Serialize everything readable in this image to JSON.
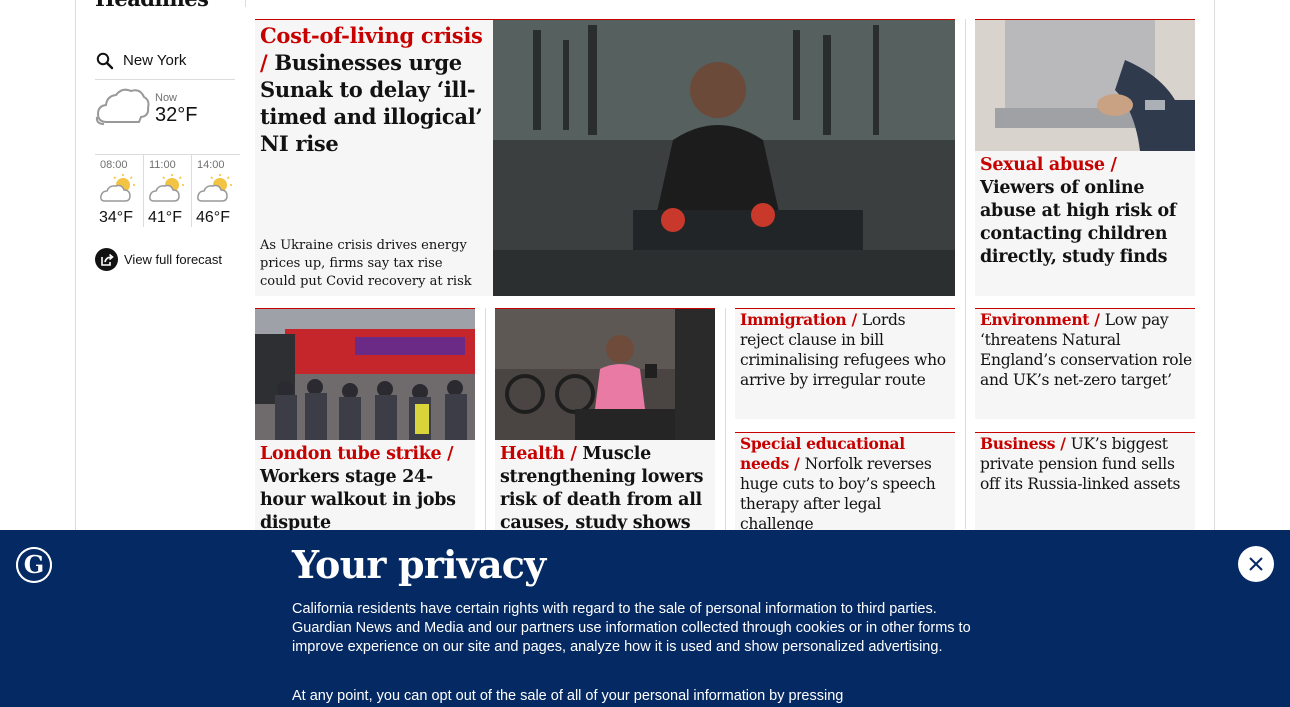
{
  "section": {
    "heading": "Headlines"
  },
  "weather": {
    "location_value": "New York",
    "now_label": "Now",
    "now_temp": "32°F",
    "forecast": [
      {
        "time": "08:00",
        "temp": "34°F"
      },
      {
        "time": "11:00",
        "temp": "41°F"
      },
      {
        "time": "14:00",
        "temp": "46°F"
      }
    ],
    "full_forecast_label": "View full forecast",
    "icons": {
      "search": "search-icon",
      "now": "cloud-icon",
      "forecast": "partly-cloudy-icon",
      "external": "external-link-icon"
    }
  },
  "stories": {
    "lead": {
      "kicker": "Cost-of-living crisis",
      "headline": "Businesses urge Sunak to delay ‘ill-timed and illogical’ NI rise",
      "standfirst": "As Ukraine crisis drives energy prices up, firms say tax rise could put Covid recovery at risk"
    },
    "side1": {
      "kicker": "Sexual abuse",
      "headline": "Viewers of online abuse at high risk of contacting children directly, study finds"
    },
    "tube": {
      "kicker": "London tube strike",
      "headline": "Workers stage 24-hour walkout in jobs dispute"
    },
    "health": {
      "kicker": "Health",
      "headline": "Muscle strengthening lowers risk of death from all causes, study shows"
    },
    "immigration": {
      "kicker": "Immigration",
      "headline": "Lords reject clause in bill criminalising refugees who arrive by irregular route"
    },
    "environment": {
      "kicker": "Environment",
      "headline": "Low pay ‘threatens Natural England’s conservation role and UK’s net-zero target’"
    },
    "sen": {
      "kicker": "Special educational needs",
      "headline": "Norfolk reverses huge cuts to boy’s speech therapy after legal challenge"
    },
    "business": {
      "kicker": "Business",
      "headline": "UK’s biggest private pension fund sells off its Russia-linked assets"
    },
    "separator": " / "
  },
  "privacy": {
    "title": "Your privacy",
    "body": "California residents have certain rights with regard to the sale of personal information to third parties. Guardian News and Media and our partners use information collected through cookies or in other forms to improve experience on our site and pages, analyze how it is used and show personalized advertising.",
    "body2": "At any point, you can opt out of the sale of all of your personal information by pressing",
    "logo_letter": "G",
    "close_icon": "close-icon"
  },
  "colors": {
    "kicker": "#c70000",
    "banner": "#052962",
    "rule": "#dcdcdc",
    "card_bg": "#f6f6f6"
  }
}
